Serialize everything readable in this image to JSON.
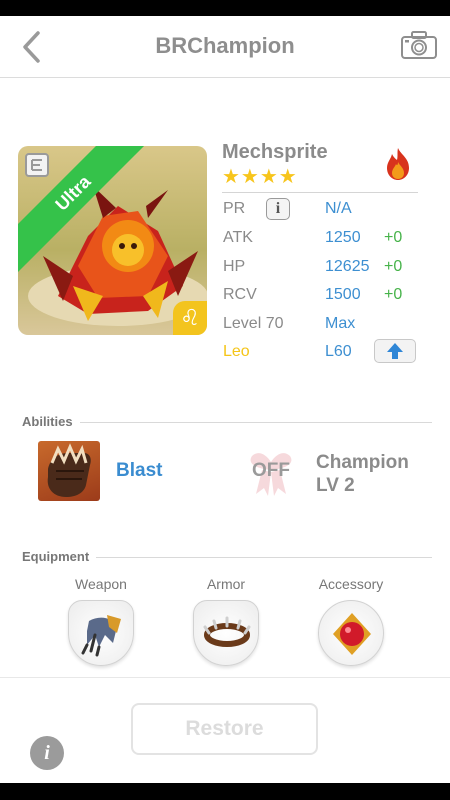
{
  "header": {
    "title": "BRChampion",
    "back_icon": "chevron-left-icon",
    "camera_icon": "camera-icon"
  },
  "monster": {
    "name": "Mechsprite",
    "rarity_label": "Ultra",
    "stars": "★★★★",
    "star_count": 4,
    "element_icon": "fire-icon",
    "zodiac_symbol": "♌",
    "stats": [
      {
        "label": "PR",
        "value": "N/A",
        "bonus": ""
      },
      {
        "label": "ATK",
        "value": "1250",
        "bonus": "+0"
      },
      {
        "label": "HP",
        "value": "12625",
        "bonus": "+0"
      },
      {
        "label": "RCV",
        "value": "1500",
        "bonus": "+0"
      },
      {
        "label": "Level 70",
        "value": "Max",
        "bonus": ""
      },
      {
        "label": "Leo",
        "value": "L60",
        "bonus": ""
      }
    ],
    "info_button": "i"
  },
  "abilities": {
    "title": "Abilities",
    "ability_name": "Blast",
    "champion_status": "OFF",
    "champion_label": "Champion",
    "champion_level": "LV 2"
  },
  "equipment": {
    "title": "Equipment",
    "slots": [
      {
        "label": "Weapon",
        "icon": "claw-weapon-icon"
      },
      {
        "label": "Armor",
        "icon": "spiked-collar-icon"
      },
      {
        "label": "Accessory",
        "icon": "ruby-amulet-icon"
      }
    ]
  },
  "footer": {
    "restore_label": "Restore",
    "info_label": "i"
  },
  "colors": {
    "stat_value": "#3d8fd1",
    "stat_bonus": "#47b34a",
    "leo": "#f5c518",
    "ultra_banner": "#35c24a"
  }
}
